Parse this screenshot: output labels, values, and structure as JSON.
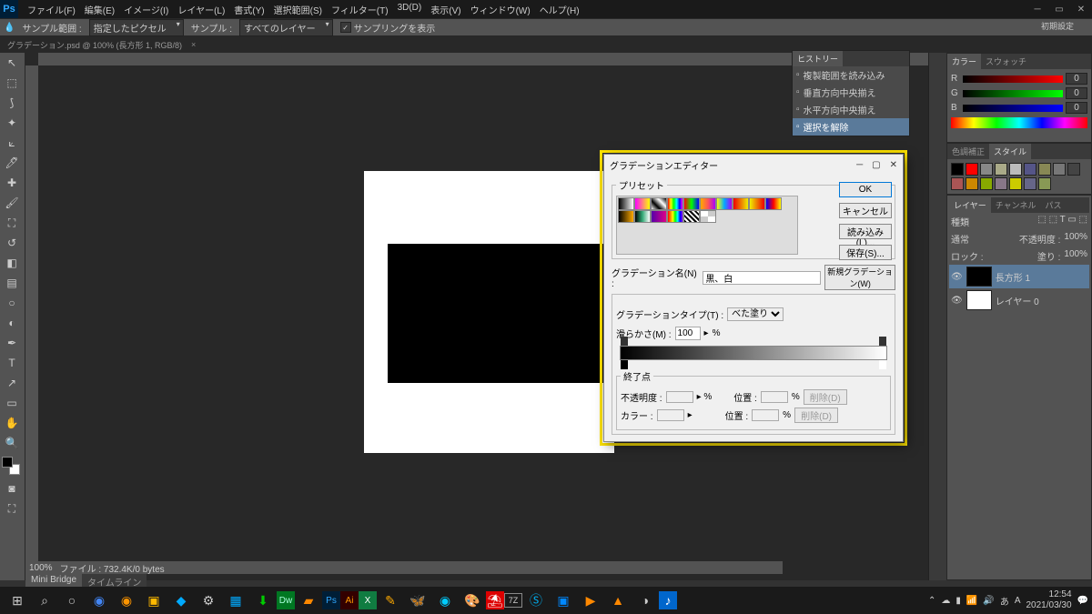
{
  "app": {
    "name": "Ps"
  },
  "menu": [
    "ファイル(F)",
    "編集(E)",
    "イメージ(I)",
    "レイヤー(L)",
    "書式(Y)",
    "選択範囲(S)",
    "フィルター(T)",
    "3D(D)",
    "表示(V)",
    "ウィンドウ(W)",
    "ヘルプ(H)"
  ],
  "options": {
    "sample_label": "サンプル範囲 :",
    "sample_value": "指定したピクセル",
    "sample2_label": "サンプル :",
    "sample2_value": "すべてのレイヤー",
    "show_sampling": "サンプリングを表示"
  },
  "workspace": "初期設定",
  "doc": {
    "tab": "グラデーション.psd @ 100% (長方形 1, RGB/8)"
  },
  "status": {
    "zoom": "100%",
    "info": "ファイル : 732.4K/0 bytes"
  },
  "bottom_tabs": [
    "Mini Bridge",
    "タイムライン"
  ],
  "history": {
    "title": "ヒストリー",
    "items": [
      "複製範囲を読み込み",
      "垂直方向中央揃え",
      "水平方向中央揃え",
      "選択を解除"
    ]
  },
  "color_panel": {
    "tabs": [
      "カラー",
      "スウォッチ"
    ],
    "r": "0",
    "g": "0",
    "b": "0"
  },
  "adjust_panel": {
    "tabs": [
      "色調補正",
      "スタイル"
    ]
  },
  "swatch_colors": [
    "#000",
    "#f00",
    "#888",
    "#aa8",
    "#bbb",
    "#558",
    "#885",
    "#777",
    "#444",
    "#a55",
    "#c80",
    "#8a0",
    "#878",
    "#cc0",
    "#668",
    "#895"
  ],
  "layers": {
    "tabs": [
      "レイヤー",
      "チャンネル",
      "パス"
    ],
    "kind": "種類",
    "mode": "通常",
    "opacity_label": "不透明度 :",
    "opacity": "100%",
    "lock_label": "ロック :",
    "fill_label": "塗り :",
    "fill": "100%",
    "items": [
      {
        "name": "長方形 1",
        "sel": true,
        "black": true
      },
      {
        "name": "レイヤー 0",
        "sel": false,
        "black": false
      }
    ]
  },
  "dialog": {
    "title": "グラデーションエディター",
    "presets_label": "プリセット",
    "ok": "OK",
    "cancel": "キャンセル",
    "load": "読み込み(L)...",
    "save": "保存(S)...",
    "name_label": "グラデーション名(N) :",
    "name_value": "黒、白",
    "new_btn": "新規グラデーション(W)",
    "type_label": "グラデーションタイプ(T) :",
    "type_value": "べた塗り",
    "smooth_label": "滑らかさ(M) :",
    "smooth_value": "100",
    "stops_label": "終了点",
    "opacity_label": "不透明度 :",
    "position_label": "位置 :",
    "color_label": "カラー :",
    "delete": "削除(D)",
    "percent": "%"
  },
  "presets": [
    "linear-gradient(to right,#000,#fff)",
    "linear-gradient(to right,#f0f,#ff0)",
    "linear-gradient(45deg,#fff,#000,#fff,#000)",
    "linear-gradient(to right,#f00,#ff0,#0f0,#0ff,#00f,#f0f)",
    "linear-gradient(to right,#f00,#0f0,#00f)",
    "linear-gradient(to right,#fa0,#f55,#a0f)",
    "linear-gradient(to right,#ff0,#0af,#a0f)",
    "linear-gradient(to right,#e00,#ee0)",
    "linear-gradient(to right,#ee0,#e00)",
    "linear-gradient(to right,#00f,#f00,#ff0)",
    "linear-gradient(to right,#000,#fa0)",
    "linear-gradient(to right,#000,#3a7,#fff)",
    "linear-gradient(to right,#50a,#d08)",
    "linear-gradient(to right,#f00,#ff8000,#ff0,#0f0,#0ff,#00f,#80f)",
    "repeating-linear-gradient(45deg,#000 0 2px,#fff 2px 4px)",
    "repeating-conic-gradient(#ccc 0 25%,#fff 0 50%)"
  ],
  "taskbar": {
    "time": "12:54",
    "date": "2021/03/30"
  }
}
